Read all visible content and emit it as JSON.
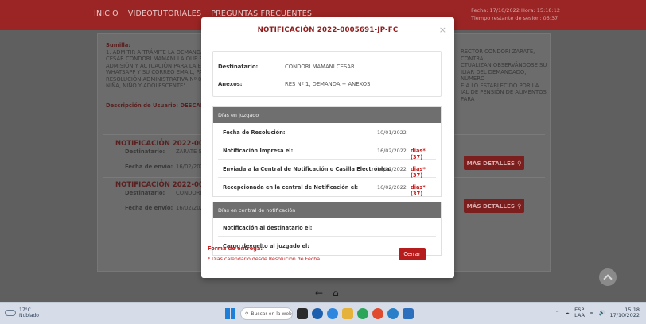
{
  "topbar": {
    "nav": [
      "INICIO",
      "VIDEOTUTORIALES",
      "PREGUNTAS FRECUENTES"
    ],
    "fecha": "Fecha: 17/10/2022 Hora: 15:18:12",
    "tiempo": "Tiempo restante de sesión: 06:37"
  },
  "background": {
    "sumilla_label": "Sumilla:",
    "sumilla_lines": [
      "1. ADMITIR A TRÁMITE LA DEMANDA DE",
      "CESAR CONDORI MAMANI LA QUE SE TR",
      "ADMISIÓN Y ACTUACIÓN PARA LA ETAP",
      "WHATSAPP Y SU CORREO EMAIL, PARA E",
      "RESOLUCIÓN ADMINISTRATIVA Nº 0001",
      "NIÑA, NIÑO Y ADOLESCENTE\"."
    ],
    "sumilla_right": [
      "RECTOR CONDORI ZARATE, CONTRA",
      "CTUALIZAN OBSERVÁNDOSE SU",
      "ILIAR DEL DEMANDADO, NÚMERO",
      "E A LO ESTABLECIDO POR LA",
      "IAL DE PENSIÓN DE ALIMENTOS PARA"
    ],
    "descripcion": "Descripción de Usuario: DESCARGADO",
    "notif1": {
      "title": "NOTIFICACIÓN 2022-000569",
      "dest_label": "Destinatario:",
      "dest_value": "ZARATE SEV",
      "fecha_label": "Fecha de envío:",
      "fecha_value": "16/02/2022"
    },
    "notif2": {
      "title": "NOTIFICACIÓN 2022-000569",
      "dest_label": "Destinatario:",
      "dest_value": "CONDORI M",
      "fecha_label": "Fecha de envío:",
      "fecha_value": "16/02/2022"
    },
    "mas_detalles": "MÁS DETALLES"
  },
  "modal": {
    "title": "NOTIFICACIÓN 2022-0005691-JP-FC",
    "close": "×",
    "destinatario_label": "Destinatario:",
    "destinatario_value": "CONDORI MAMANI CESAR",
    "anexos_label": "Anexos:",
    "anexos_value": "RES Nº 1, DEMANDA + ANEXOS",
    "juzgado": {
      "header": "Días en Juzgado",
      "rows": [
        {
          "label": "Fecha de Resolución:",
          "date": "10/01/2022",
          "dias": ""
        },
        {
          "label": "Notificación Impresa el:",
          "date": "16/02/2022",
          "dias": "dias*(37)"
        },
        {
          "label": "Enviada a la Central de Notificación o Casilla Electrónica:",
          "date": "16/02/2022",
          "dias": "dias*(37)"
        },
        {
          "label": "Recepcionada en la central de Notificación el:",
          "date": "16/02/2022",
          "dias": "dias*(37)"
        }
      ]
    },
    "central": {
      "header": "Días en central de notificación",
      "rows": [
        {
          "label": "Notificación al destinatario el:"
        },
        {
          "label": "Cargo devuelto al juzgado el:"
        }
      ]
    },
    "forma_entrega": "Forma de entrega:",
    "nota": "* Días calendario desde Resolución de Fecha",
    "cerrar": "Cerrar"
  },
  "taskbar": {
    "temp": "17°C",
    "weather": "Nublado",
    "search": "Buscar en la web",
    "lang": "ESP",
    "lang2": "LAA",
    "time": "15:18",
    "date": "17/10/2022"
  },
  "colors": {
    "brand": "#8f1d1d",
    "accent_red": "#c41e1e",
    "section_header": "#6f6f6f"
  }
}
